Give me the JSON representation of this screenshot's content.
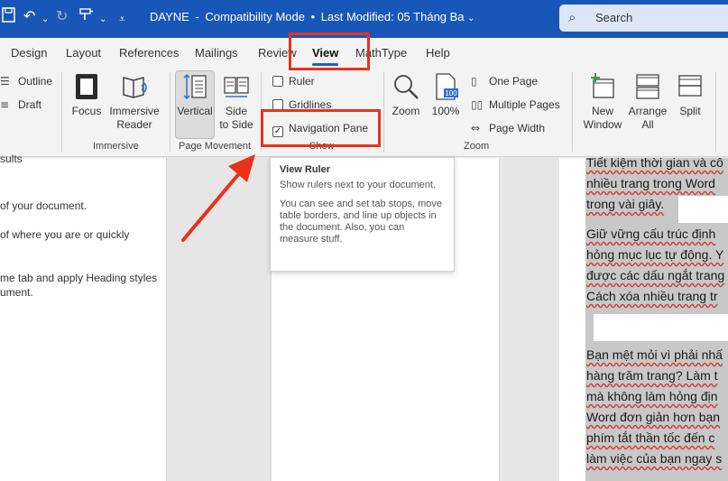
{
  "titlebar": {
    "doc_name": "DAYNE",
    "mode": "Compatibility Mode",
    "modified": "Last Modified: 05 Tháng Ba",
    "search_placeholder": "Search",
    "undo_icon": "undo-icon",
    "redo_icon": "redo-icon",
    "save_icon": "save-icon",
    "quick_access_icon": "customize-quick-access-icon"
  },
  "tabs": [
    "Design",
    "Layout",
    "References",
    "Mailings",
    "Review",
    "View",
    "MathType",
    "Help"
  ],
  "active_tab": "View",
  "ribbon": {
    "views": {
      "outline": "Outline",
      "draft": "Draft"
    },
    "immersive": {
      "focus": "Focus",
      "reader_line1": "Immersive",
      "reader_line2": "Reader",
      "label": "Immersive"
    },
    "page_movement": {
      "vertical": "Vertical",
      "side_line1": "Side",
      "side_line2": "to Side",
      "label": "Page Movement"
    },
    "show": {
      "ruler": "Ruler",
      "gridlines": "Gridlines",
      "navigation_pane": "Navigation Pane",
      "label": "Show",
      "ruler_checked": false,
      "gridlines_checked": false,
      "navigation_pane_checked": true
    },
    "zoom": {
      "zoom": "Zoom",
      "hundred": "100%",
      "one_page": "One Page",
      "multiple_pages": "Multiple Pages",
      "page_width": "Page Width",
      "label": "Zoom"
    },
    "window": {
      "new_line1": "New",
      "new_line2": "Window",
      "arrange_line1": "Arrange",
      "arrange_line2": "All",
      "split": "Split"
    }
  },
  "tooltip": {
    "title": "View Ruler",
    "desc1": "Show rulers next to your document.",
    "desc2": "You can see and set tab stops, move table borders, and line up objects in the document. Also, you can measure stuff."
  },
  "navpane": {
    "lines": [
      "sults",
      "of your document.",
      "of where you are or quickly",
      "me tab and apply Heading styles",
      "ument."
    ]
  },
  "document": {
    "lines": [
      "Tiết kiệm thời gian và cô",
      "nhiều trang trong Word",
      "trong vài giây.",
      "Giữ vững cấu trúc định",
      "hỏng mục lục tự động. Y",
      "được các dấu ngắt trang",
      "Cách xóa nhiều trang tr",
      "Bạn mệt mỏi vì phải nhấ",
      "hàng trăm trang? Làm t",
      "mà không làm hỏng địn",
      "Word đơn giản hơn bạn",
      "phím tắt thần tốc đến c",
      "làm việc của bạn ngay s"
    ]
  },
  "colors": {
    "titlebar": "#1857b8",
    "annotation": "#e8321c",
    "ribbon_bg": "#f3f3f3"
  }
}
